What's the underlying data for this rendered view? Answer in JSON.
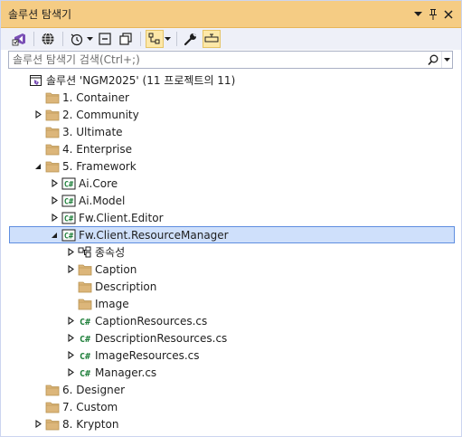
{
  "window": {
    "title": "솔루션 탐색기",
    "controls": [
      "dropdown-arrow",
      "pin",
      "close"
    ]
  },
  "toolbar": {
    "buttons": [
      {
        "name": "visual-studio-icon"
      },
      {
        "name": "globe-icon"
      },
      {
        "name": "history-icon",
        "dropdown": true
      },
      {
        "name": "collapse-all-icon"
      },
      {
        "name": "copy-icon"
      },
      {
        "name": "switch-views-icon",
        "dropdown": true,
        "active": true
      },
      {
        "name": "wrench-icon"
      },
      {
        "name": "preview-icon",
        "active": true
      }
    ]
  },
  "search": {
    "placeholder": "솔루션 탐색기 검색(Ctrl+;)",
    "value": ""
  },
  "tree": [
    {
      "label": "솔루션 'NGM2025'  (11 프로젝트의 11)",
      "icon": "solution",
      "indent": 0,
      "expander": "none"
    },
    {
      "label": "1. Container",
      "icon": "folder",
      "indent": 1,
      "expander": "none"
    },
    {
      "label": "2. Community",
      "icon": "folder",
      "indent": 1,
      "expander": "collapsed"
    },
    {
      "label": "3. Ultimate",
      "icon": "folder",
      "indent": 1,
      "expander": "none"
    },
    {
      "label": "4. Enterprise",
      "icon": "folder",
      "indent": 1,
      "expander": "none"
    },
    {
      "label": "5. Framework",
      "icon": "folder",
      "indent": 1,
      "expander": "expanded"
    },
    {
      "label": "Ai.Core",
      "icon": "csproj",
      "indent": 2,
      "expander": "collapsed"
    },
    {
      "label": "Ai.Model",
      "icon": "csproj",
      "indent": 2,
      "expander": "collapsed"
    },
    {
      "label": "Fw.Client.Editor",
      "icon": "csproj",
      "indent": 2,
      "expander": "collapsed"
    },
    {
      "label": "Fw.Client.ResourceManager",
      "icon": "csproj",
      "indent": 2,
      "expander": "expanded",
      "selected": true
    },
    {
      "label": "종속성",
      "icon": "dependencies",
      "indent": 3,
      "expander": "collapsed"
    },
    {
      "label": "Caption",
      "icon": "folder",
      "indent": 3,
      "expander": "collapsed"
    },
    {
      "label": "Description",
      "icon": "folder",
      "indent": 3,
      "expander": "none"
    },
    {
      "label": "Image",
      "icon": "folder",
      "indent": 3,
      "expander": "none"
    },
    {
      "label": "CaptionResources.cs",
      "icon": "csfile",
      "indent": 3,
      "expander": "collapsed"
    },
    {
      "label": "DescriptionResources.cs",
      "icon": "csfile",
      "indent": 3,
      "expander": "collapsed"
    },
    {
      "label": "ImageResources.cs",
      "icon": "csfile",
      "indent": 3,
      "expander": "collapsed"
    },
    {
      "label": "Manager.cs",
      "icon": "csfile",
      "indent": 3,
      "expander": "collapsed"
    },
    {
      "label": "6. Designer",
      "icon": "folder",
      "indent": 1,
      "expander": "none"
    },
    {
      "label": "7. Custom",
      "icon": "folder",
      "indent": 1,
      "expander": "none"
    },
    {
      "label": "8. Krypton",
      "icon": "folder",
      "indent": 1,
      "expander": "collapsed"
    }
  ],
  "colors": {
    "titlebar": "#f5cc84",
    "toolbar": "#eef0f8",
    "selection": "#cfe0fb",
    "selection_border": "#5f8ee0",
    "folder": "#dcb67a",
    "csharp": "#1e7f3a"
  }
}
